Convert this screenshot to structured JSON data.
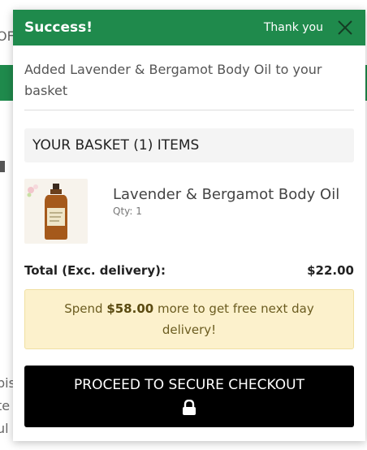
{
  "background": {
    "frag_top": "OF",
    "frag_bottom": [
      "pis",
      "te",
      "ul"
    ]
  },
  "popup": {
    "title": "Success!",
    "thanks": "Thank you",
    "close_icon": "close-icon",
    "added_message": "Added Lavender & Bergamot Body Oil to your basket",
    "basket_heading": "YOUR BASKET (1) ITEMS",
    "items": [
      {
        "name": "Lavender & Bergamot Body Oil",
        "qty": "Qty: 1",
        "image": "body-oil-bottle"
      }
    ],
    "total_label": "Total (Exc. delivery):",
    "total_value": "$22.00",
    "delivery": {
      "prefix": "Spend ",
      "amount": "$58.00",
      "suffix": " more to get free next day delivery!"
    },
    "checkout_label": "PROCEED TO SECURE CHECKOUT",
    "checkout_icon": "lock-icon"
  },
  "colors": {
    "brand_green": "#1f8a4c",
    "notice_bg": "#fcf1cc",
    "button_bg": "#000000"
  }
}
